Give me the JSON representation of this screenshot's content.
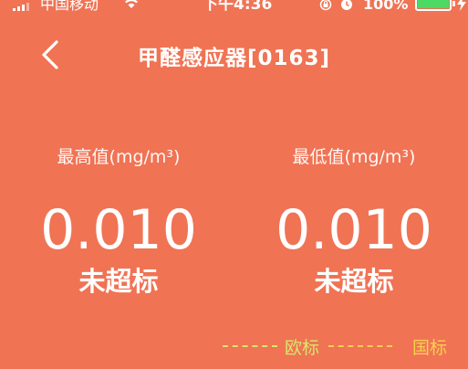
{
  "status_bar": {
    "carrier": "中国移动",
    "time": "下午4:36",
    "battery_percent": "100%",
    "battery_level": 1.0
  },
  "nav": {
    "title": "甲醛感应器[0163]"
  },
  "readings": {
    "max": {
      "label": "最高值(mg/m³)",
      "value": "0.010",
      "status": "未超标"
    },
    "min": {
      "label": "最低值(mg/m³)",
      "value": "0.010",
      "status": "未超标"
    }
  },
  "legend": {
    "eu_label": "欧标",
    "cn_label": "国标"
  },
  "colors": {
    "background": "#F07354",
    "eu_line": "#D6E86A",
    "cn_line": "#F6D04D",
    "battery_fill": "#4CD964"
  }
}
